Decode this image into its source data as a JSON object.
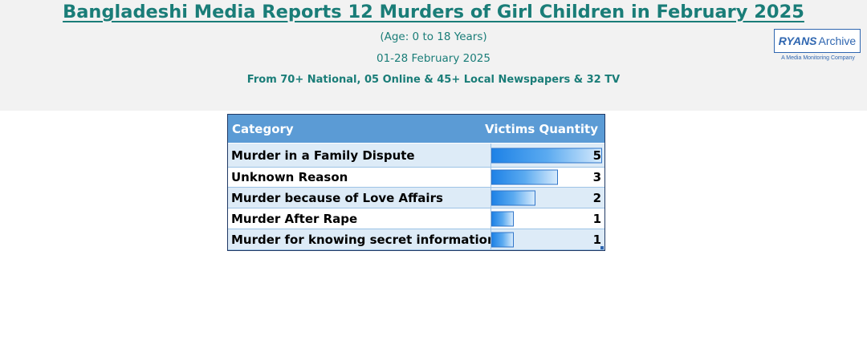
{
  "header": {
    "title": "Bangladeshi Media Reports 12 Murders of Girl Children in February 2025",
    "age_range": "(Age: 0 to 18 Years)",
    "date_range": "01-28 February 2025",
    "sources": "From 70+ National, 05 Online & 45+ Local Newspapers & 32 TV"
  },
  "logo": {
    "brand": "RYANS",
    "brand_suffix": "Archive",
    "tagline": "A Media Monitoring Company",
    "color": "#2f66b0"
  },
  "colors": {
    "title": "#1a7d78",
    "header_fill": "#5b9bd5",
    "row_shade": "#ddebf7",
    "bar": "#1e82e6"
  },
  "chart_data": {
    "type": "table",
    "columns": [
      "Category",
      "Victims Quantity"
    ],
    "rows": [
      {
        "category": "Murder in a Family Dispute",
        "value": 5
      },
      {
        "category": "Unknown Reason",
        "value": 3
      },
      {
        "category": "Murder because of Love Affairs",
        "value": 2
      },
      {
        "category": "Murder After Rape",
        "value": 1
      },
      {
        "category": "Murder for knowing secret information",
        "value": 1
      }
    ],
    "bar_max": 5
  }
}
